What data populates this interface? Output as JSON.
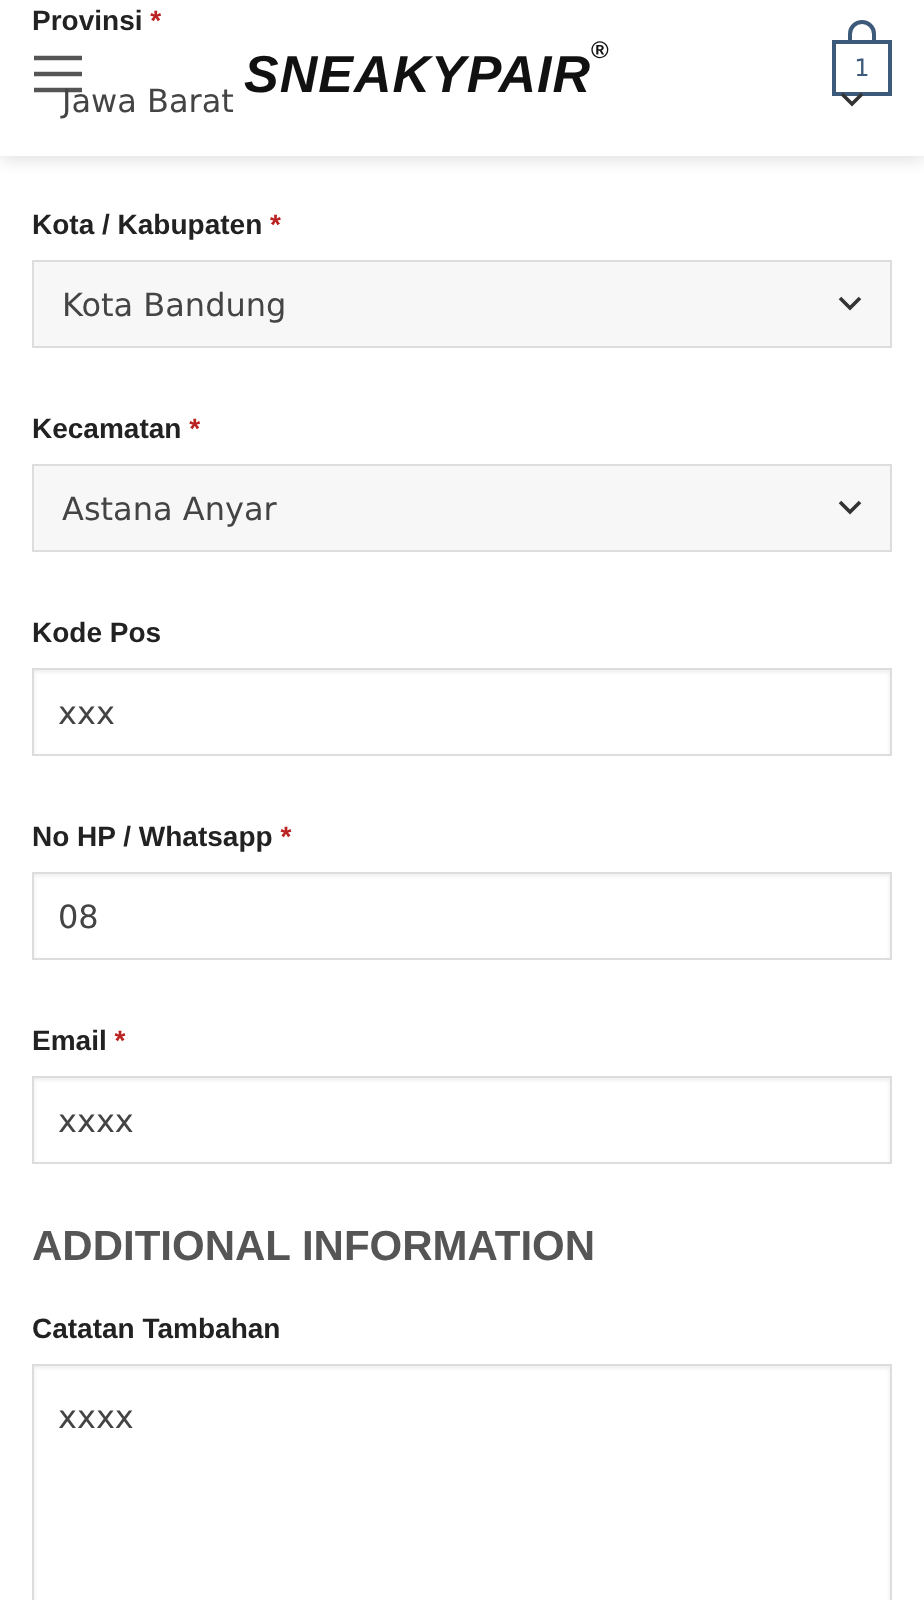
{
  "header": {
    "logo": "SNEAKYPAIR",
    "logo_mark": "®",
    "cart_count": "1"
  },
  "fields": [
    {
      "kind": "select",
      "label": "Provinsi",
      "required": true,
      "value": "Jawa Barat"
    },
    {
      "kind": "select",
      "label": "Kota / Kabupaten",
      "required": true,
      "value": "Kota Bandung"
    },
    {
      "kind": "select",
      "label": "Kecamatan",
      "required": true,
      "value": "Astana Anyar"
    },
    {
      "kind": "input",
      "label": "Kode Pos",
      "required": false,
      "value": "xxx"
    },
    {
      "kind": "input",
      "label": "No HP / Whatsapp",
      "required": true,
      "value": "08"
    },
    {
      "kind": "input",
      "label": "Email",
      "required": true,
      "value": "xxxx"
    }
  ],
  "additional": {
    "heading": "ADDITIONAL INFORMATION",
    "label": "Catatan Tambahan",
    "value": "xxxx"
  },
  "required_mark": "*"
}
